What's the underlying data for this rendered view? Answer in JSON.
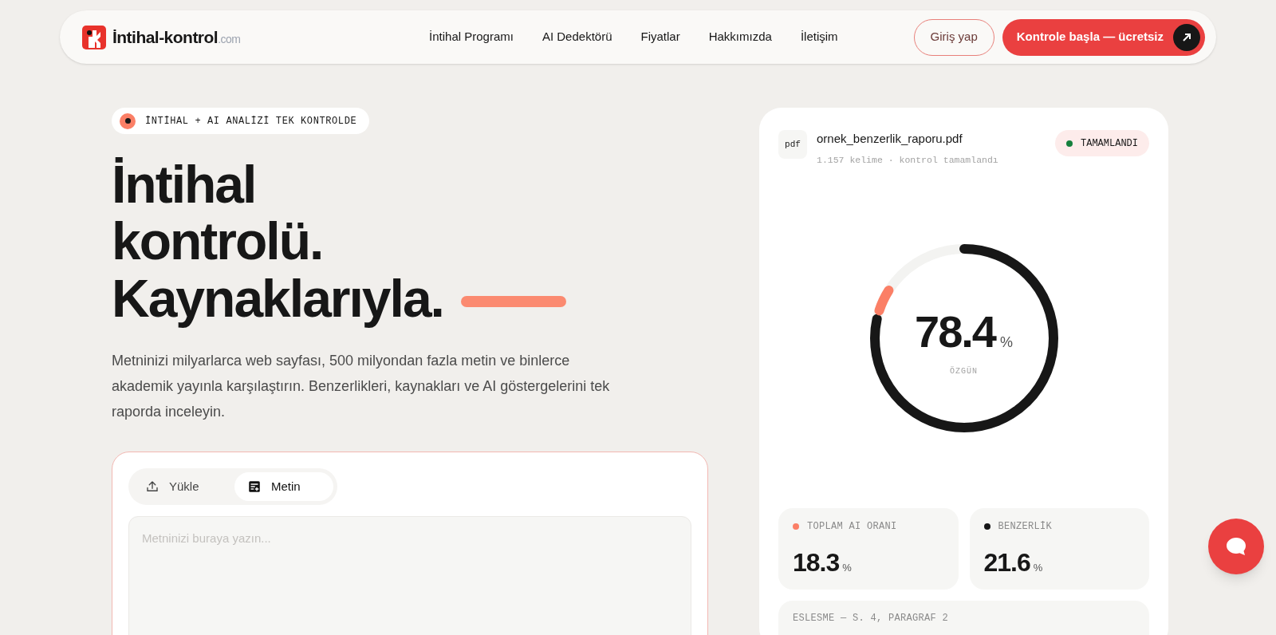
{
  "nav": {
    "logo": {
      "name": "İntihal-kontrol",
      "suffix": ".com"
    },
    "links": [
      "İntihal Programı",
      "AI Dedektörü",
      "Fiyatlar",
      "Hakkımızda",
      "İletişim"
    ],
    "login": "Giriş yap",
    "cta": "Kontrole başla — ücretsiz"
  },
  "hero": {
    "badge": "İNTİHAL + AI ANALİZİ TEK KONTROLDE",
    "title_lines": [
      "İntihal",
      "kontrolü.",
      "Kaynaklarıyla."
    ],
    "description": "Metninizi milyarlarca web sayfası, 500 milyondan fazla metin ve binlerce akademik yayınla karşılaştırın. Benzerlikleri, kaynakları ve AI göstergelerini tek raporda inceleyin.",
    "tabs": [
      {
        "label": "Yükle",
        "kind": "upload",
        "selected": false
      },
      {
        "label": "Metin",
        "kind": "text",
        "selected": true
      }
    ],
    "input": {
      "placeholder": "Metninizi buraya yazın..."
    }
  },
  "report": {
    "file_type": "pdf",
    "file_name": "ornek_benzerlik_raporu.pdf",
    "file_meta": "1.157 kelime · kontrol tamamlandı",
    "status": {
      "label": "TAMAMLANDI",
      "color": "#15803d"
    },
    "gauge": {
      "value": "78.4",
      "unit": "%",
      "label": "ÖZGÜN",
      "level": 0.784
    },
    "stats": [
      {
        "label": "TOPLAM AI ORANI",
        "value": "18.3",
        "unit": "%",
        "color": "#fb7f66"
      },
      {
        "label": "BENZERLİK",
        "value": "21.6",
        "unit": "%",
        "color": "#171717"
      }
    ],
    "match_heading": "ESLESME — S. 4, PARAGRAF 2"
  }
}
